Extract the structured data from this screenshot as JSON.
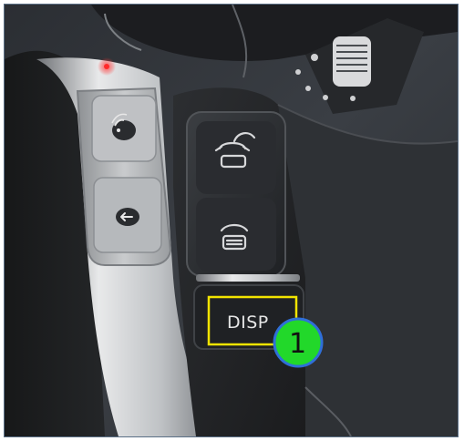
{
  "buttons": {
    "disp_label": "DISP",
    "callout_number": "1"
  },
  "icons": [
    "voice-command-icon",
    "back-return-icon",
    "phone-off-hook-icon",
    "phone-on-hook-icon"
  ],
  "colors": {
    "highlight_box": "#f2e400",
    "callout_fill": "#22d82a",
    "callout_stroke": "#2f6fd8",
    "frame_border": "#5a6f86",
    "indicator_led": "#ff2a2a"
  }
}
